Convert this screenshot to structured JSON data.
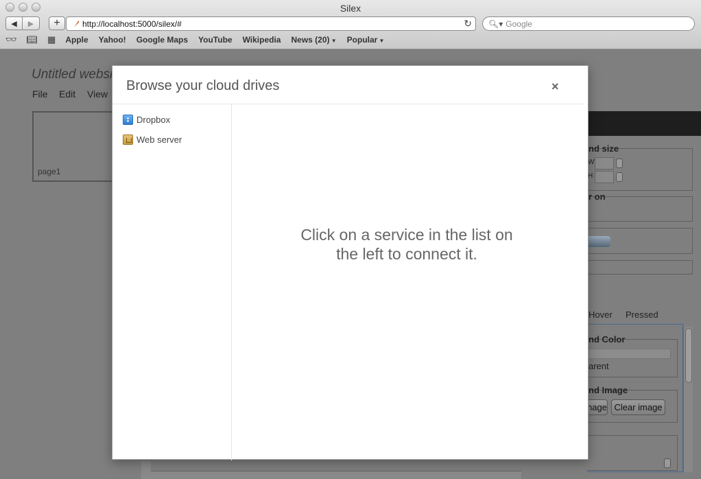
{
  "browser": {
    "window_title": "Silex",
    "url": "http://localhost:5000/silex/#",
    "search_placeholder": "Google",
    "bookmarks": [
      "Apple",
      "Yahoo!",
      "Google Maps",
      "YouTube",
      "Wikipedia",
      "News (20)",
      "Popular"
    ]
  },
  "app": {
    "site_title": "Untitled website",
    "menu": [
      "File",
      "Edit",
      "View"
    ],
    "page_name": "page1",
    "props": {
      "size_label": "nd size",
      "w_label": "W",
      "h_label": "H",
      "visible_on_label": "r on",
      "tabs": [
        "Hover",
        "Pressed"
      ],
      "bg_color_label": "nd Color",
      "transparent_label": "arent",
      "bg_image_label": "nd Image",
      "select_image_label": "nage",
      "clear_image_label": "Clear image"
    }
  },
  "dialog": {
    "title": "Browse your cloud drives",
    "close": "×",
    "services": [
      {
        "label": "Dropbox",
        "icon": "dropbox-icon"
      },
      {
        "label": "Web server",
        "icon": "folder-icon"
      }
    ],
    "message_line1": "Click on a service in the list on",
    "message_line2": "the left to connect it."
  }
}
